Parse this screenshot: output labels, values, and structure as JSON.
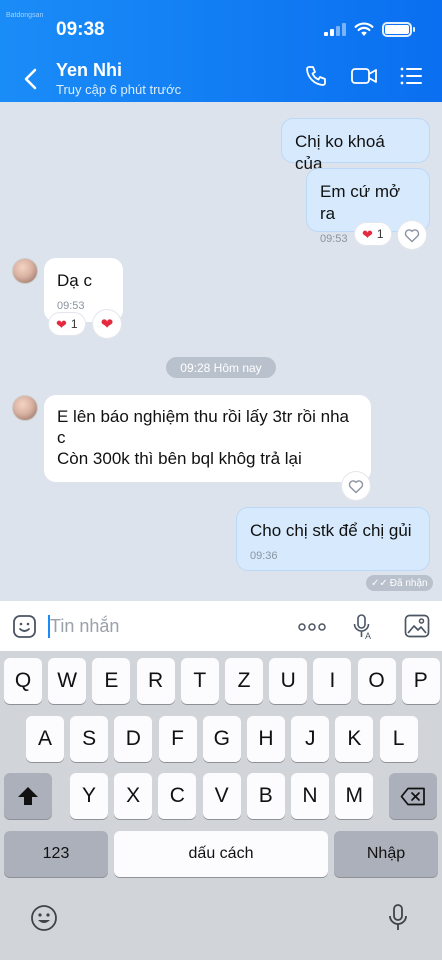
{
  "status_bar": {
    "time": "09:38",
    "watermark": "Batdongsan"
  },
  "header": {
    "name": "Yen Nhi",
    "status": "Truy cập 6 phút trước"
  },
  "messages": [
    {
      "dir": "out",
      "text": "Chị ko khoá của"
    },
    {
      "dir": "out",
      "text": "Em cứ mở ra",
      "time": "09:53",
      "reaction_count": "1"
    },
    {
      "dir": "in",
      "text": "Dạ c",
      "time": "09:53",
      "reaction_count": "1"
    },
    {
      "dir": "in",
      "text_line1": "E lên báo nghiệm thu rồi lấy 3tr rồi nha",
      "text_line2": "c",
      "text_line3": "Còn 300k thì bên bql khôg trả lại"
    },
    {
      "dir": "out",
      "text": "Cho chị stk để chị gủi",
      "time": "09:36"
    }
  ],
  "date_separator": "09:28 Hôm nay",
  "seen_label": "Đã nhận",
  "input": {
    "placeholder": "Tin nhắn"
  },
  "keyboard": {
    "row1": [
      "Q",
      "W",
      "E",
      "R",
      "T",
      "Z",
      "U",
      "I",
      "O",
      "P"
    ],
    "row2": [
      "A",
      "S",
      "D",
      "F",
      "G",
      "H",
      "J",
      "K",
      "L"
    ],
    "row3": [
      "Y",
      "X",
      "C",
      "V",
      "B",
      "N",
      "M"
    ],
    "numbers_label": "123",
    "space_label": "dấu cách",
    "return_label": "Nhập"
  },
  "colors": {
    "header": "#0a6ff0",
    "outgoing_bubble": "#d7eafd",
    "incoming_bubble": "#ffffff",
    "heart": "#e5293e"
  }
}
